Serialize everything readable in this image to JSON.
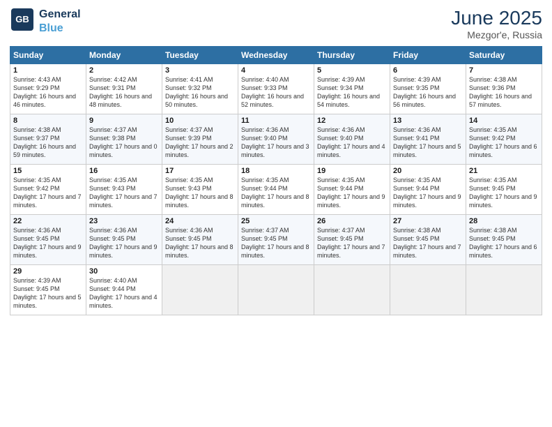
{
  "logo": {
    "line1": "General",
    "line2": "Blue"
  },
  "title": "June 2025",
  "location": "Mezgor'e, Russia",
  "days_header": [
    "Sunday",
    "Monday",
    "Tuesday",
    "Wednesday",
    "Thursday",
    "Friday",
    "Saturday"
  ],
  "weeks": [
    [
      {
        "day": "1",
        "sunrise": "4:43 AM",
        "sunset": "9:29 PM",
        "daylight": "16 hours and 46 minutes."
      },
      {
        "day": "2",
        "sunrise": "4:42 AM",
        "sunset": "9:31 PM",
        "daylight": "16 hours and 48 minutes."
      },
      {
        "day": "3",
        "sunrise": "4:41 AM",
        "sunset": "9:32 PM",
        "daylight": "16 hours and 50 minutes."
      },
      {
        "day": "4",
        "sunrise": "4:40 AM",
        "sunset": "9:33 PM",
        "daylight": "16 hours and 52 minutes."
      },
      {
        "day": "5",
        "sunrise": "4:39 AM",
        "sunset": "9:34 PM",
        "daylight": "16 hours and 54 minutes."
      },
      {
        "day": "6",
        "sunrise": "4:39 AM",
        "sunset": "9:35 PM",
        "daylight": "16 hours and 56 minutes."
      },
      {
        "day": "7",
        "sunrise": "4:38 AM",
        "sunset": "9:36 PM",
        "daylight": "16 hours and 57 minutes."
      }
    ],
    [
      {
        "day": "8",
        "sunrise": "4:38 AM",
        "sunset": "9:37 PM",
        "daylight": "16 hours and 59 minutes."
      },
      {
        "day": "9",
        "sunrise": "4:37 AM",
        "sunset": "9:38 PM",
        "daylight": "17 hours and 0 minutes."
      },
      {
        "day": "10",
        "sunrise": "4:37 AM",
        "sunset": "9:39 PM",
        "daylight": "17 hours and 2 minutes."
      },
      {
        "day": "11",
        "sunrise": "4:36 AM",
        "sunset": "9:40 PM",
        "daylight": "17 hours and 3 minutes."
      },
      {
        "day": "12",
        "sunrise": "4:36 AM",
        "sunset": "9:40 PM",
        "daylight": "17 hours and 4 minutes."
      },
      {
        "day": "13",
        "sunrise": "4:36 AM",
        "sunset": "9:41 PM",
        "daylight": "17 hours and 5 minutes."
      },
      {
        "day": "14",
        "sunrise": "4:35 AM",
        "sunset": "9:42 PM",
        "daylight": "17 hours and 6 minutes."
      }
    ],
    [
      {
        "day": "15",
        "sunrise": "4:35 AM",
        "sunset": "9:42 PM",
        "daylight": "17 hours and 7 minutes."
      },
      {
        "day": "16",
        "sunrise": "4:35 AM",
        "sunset": "9:43 PM",
        "daylight": "17 hours and 7 minutes."
      },
      {
        "day": "17",
        "sunrise": "4:35 AM",
        "sunset": "9:43 PM",
        "daylight": "17 hours and 8 minutes."
      },
      {
        "day": "18",
        "sunrise": "4:35 AM",
        "sunset": "9:44 PM",
        "daylight": "17 hours and 8 minutes."
      },
      {
        "day": "19",
        "sunrise": "4:35 AM",
        "sunset": "9:44 PM",
        "daylight": "17 hours and 9 minutes."
      },
      {
        "day": "20",
        "sunrise": "4:35 AM",
        "sunset": "9:44 PM",
        "daylight": "17 hours and 9 minutes."
      },
      {
        "day": "21",
        "sunrise": "4:35 AM",
        "sunset": "9:45 PM",
        "daylight": "17 hours and 9 minutes."
      }
    ],
    [
      {
        "day": "22",
        "sunrise": "4:36 AM",
        "sunset": "9:45 PM",
        "daylight": "17 hours and 9 minutes."
      },
      {
        "day": "23",
        "sunrise": "4:36 AM",
        "sunset": "9:45 PM",
        "daylight": "17 hours and 9 minutes."
      },
      {
        "day": "24",
        "sunrise": "4:36 AM",
        "sunset": "9:45 PM",
        "daylight": "17 hours and 8 minutes."
      },
      {
        "day": "25",
        "sunrise": "4:37 AM",
        "sunset": "9:45 PM",
        "daylight": "17 hours and 8 minutes."
      },
      {
        "day": "26",
        "sunrise": "4:37 AM",
        "sunset": "9:45 PM",
        "daylight": "17 hours and 7 minutes."
      },
      {
        "day": "27",
        "sunrise": "4:38 AM",
        "sunset": "9:45 PM",
        "daylight": "17 hours and 7 minutes."
      },
      {
        "day": "28",
        "sunrise": "4:38 AM",
        "sunset": "9:45 PM",
        "daylight": "17 hours and 6 minutes."
      }
    ],
    [
      {
        "day": "29",
        "sunrise": "4:39 AM",
        "sunset": "9:45 PM",
        "daylight": "17 hours and 5 minutes."
      },
      {
        "day": "30",
        "sunrise": "4:40 AM",
        "sunset": "9:44 PM",
        "daylight": "17 hours and 4 minutes."
      },
      null,
      null,
      null,
      null,
      null
    ]
  ]
}
